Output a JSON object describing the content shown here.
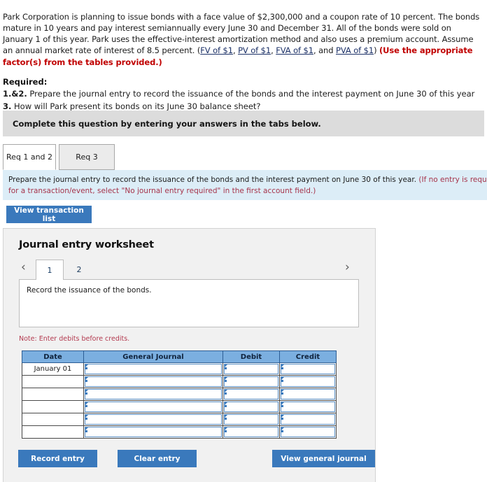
{
  "problem": {
    "text_part1": "Park Corporation is planning to issue bonds with a face value of $2,300,000 and a coupon rate of 10 percent. The bonds mature in 10 years and pay interest semiannually every June 30 and December 31. All of the bonds were sold on January 1 of this year. Park uses the effective-interest amortization method and also uses a premium account. Assume an annual market rate of interest of 8.5 percent. (",
    "link_fv": "FV of $1",
    "sep1": ", ",
    "link_pv": "PV of $1",
    "sep2": ", ",
    "link_fva": "FVA of $1",
    "sep3": ", and ",
    "link_pva": "PVA of $1",
    "text_part2": ") ",
    "emphasis": "(Use the appropriate factor(s) from the tables provided.)"
  },
  "required": {
    "heading": "Required:",
    "item1_num": "1.&2.",
    "item1_text": " Prepare the journal entry to record the issuance of the bonds and the interest payment on June 30 of this year",
    "item2_num": "3.",
    "item2_text": " How will Park present its bonds on its June 30 balance sheet?"
  },
  "gray_banner": {
    "text": "Complete this question by entering your answers in the tabs below."
  },
  "tabs": [
    {
      "label": "Req 1 and 2",
      "active": true
    },
    {
      "label": "Req 3",
      "active": false
    }
  ],
  "blue_banner": {
    "line1_black": "Prepare the journal entry to record the issuance of the bonds and the interest payment on June 30 of this year. ",
    "line1_red": "(If no entry is required",
    "line2_red": "for a transaction/event, select \"No journal entry required\" in the first account field.)"
  },
  "buttons": {
    "view_transaction_list": "View transaction list",
    "record_entry": "Record entry",
    "clear_entry": "Clear entry",
    "view_general_journal": "View general journal"
  },
  "worksheet": {
    "title": "Journal entry worksheet",
    "pager": {
      "prev_icon": "‹",
      "next_icon": "›",
      "pages": [
        {
          "label": "1",
          "active": true
        },
        {
          "label": "2",
          "active": false
        }
      ]
    },
    "prompt": "Record the issuance of the bonds.",
    "note": "Note: Enter debits before credits.",
    "table": {
      "columns": [
        "Date",
        "General Journal",
        "Debit",
        "Credit"
      ],
      "rows": [
        {
          "date": "January 01",
          "general_journal": "",
          "debit": "",
          "credit": ""
        },
        {
          "date": "",
          "general_journal": "",
          "debit": "",
          "credit": ""
        },
        {
          "date": "",
          "general_journal": "",
          "debit": "",
          "credit": ""
        },
        {
          "date": "",
          "general_journal": "",
          "debit": "",
          "credit": ""
        },
        {
          "date": "",
          "general_journal": "",
          "debit": "",
          "credit": ""
        },
        {
          "date": "",
          "general_journal": "",
          "debit": "",
          "credit": ""
        }
      ]
    }
  },
  "colors": {
    "accent_blue": "#3a79bc",
    "table_header_blue": "#7bafe0",
    "banner_blue": "#dcedf7",
    "banner_gray": "#dcdcdc",
    "panel_gray": "#f1f1f1",
    "red_text": "#c00000",
    "note_red": "#b33a4f",
    "link_navy": "#1a2f66"
  }
}
